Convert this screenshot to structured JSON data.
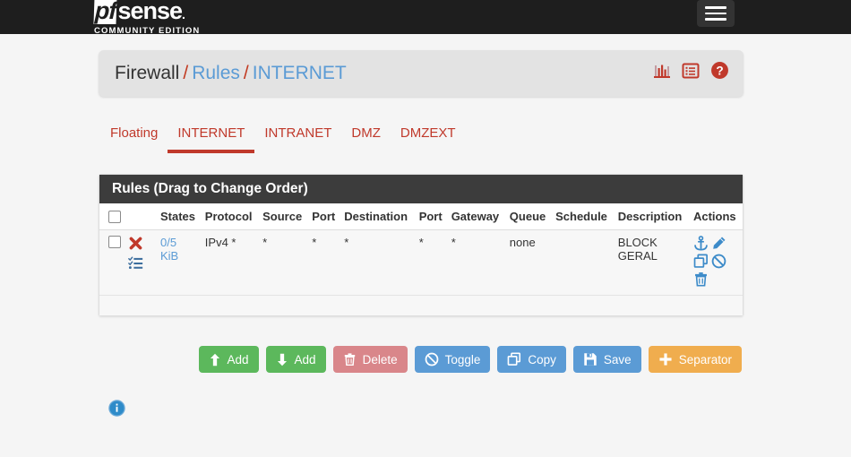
{
  "navbar": {
    "brand_main": "pfsense",
    "brand_pf": "pf",
    "brand_rest": "sense",
    "brand_dot": ".",
    "brand_sub": "COMMUNITY EDITION",
    "menu_icon": "hamburger-menu-icon"
  },
  "breadcrumb": {
    "parts": [
      "Firewall",
      "Rules",
      "INTERNET"
    ],
    "separator": "/",
    "icons": [
      {
        "name": "chart-bar-icon",
        "title": "Statistics"
      },
      {
        "name": "list-log-icon",
        "title": "Logs"
      },
      {
        "name": "help-question-icon",
        "title": "Help"
      }
    ],
    "icon_color": "#c0392b"
  },
  "tabs": [
    {
      "label": "Floating",
      "active": false
    },
    {
      "label": "INTERNET",
      "active": true
    },
    {
      "label": "INTRANET",
      "active": false
    },
    {
      "label": "DMZ",
      "active": false
    },
    {
      "label": "DMZEXT",
      "active": false
    }
  ],
  "panel": {
    "title": "Rules (Drag to Change Order)",
    "columns": [
      "States",
      "Protocol",
      "Source",
      "Port",
      "Destination",
      "Port",
      "Gateway",
      "Queue",
      "Schedule",
      "Description",
      "Actions"
    ],
    "rows": [
      {
        "selected": false,
        "action_icon": "block-x-icon",
        "advanced_icon": "tasks-list-icon",
        "states": "0/5",
        "states_unit": "KiB",
        "protocol": "IPv4 *",
        "source": "*",
        "source_port": "*",
        "destination": "*",
        "destination_port": "*",
        "gateway": "*",
        "queue": "none",
        "schedule": "",
        "description_line1": "BLOCK",
        "description_line2": "GERAL",
        "actions": [
          {
            "name": "anchor-icon",
            "title": "Move"
          },
          {
            "name": "pencil-edit-icon",
            "title": "Edit"
          },
          {
            "name": "copy-icon",
            "title": "Copy"
          },
          {
            "name": "ban-disable-icon",
            "title": "Disable"
          },
          {
            "name": "trash-delete-icon",
            "title": "Delete"
          }
        ]
      }
    ]
  },
  "buttons": [
    {
      "label": "Add",
      "icon": "arrow-up-icon",
      "style": "green"
    },
    {
      "label": "Add",
      "icon": "arrow-down-icon",
      "style": "green"
    },
    {
      "label": "Delete",
      "icon": "trash-delete-icon",
      "style": "red"
    },
    {
      "label": "Toggle",
      "icon": "ban-disable-icon",
      "style": "blue"
    },
    {
      "label": "Copy",
      "icon": "copy-icon",
      "style": "blue"
    },
    {
      "label": "Save",
      "icon": "floppy-save-icon",
      "style": "blue"
    },
    {
      "label": "Separator",
      "icon": "plus-icon",
      "style": "orange"
    }
  ],
  "footer": {
    "info_icon": "info-circle-icon",
    "info_color": "#2e8bc9"
  },
  "colors": {
    "brand_red": "#c0392b",
    "link_blue": "#5b9bd5",
    "navbar_bg": "#1e1e1e",
    "page_bg": "#f5f5f5",
    "panel_head_bg": "#3c3c3c"
  }
}
